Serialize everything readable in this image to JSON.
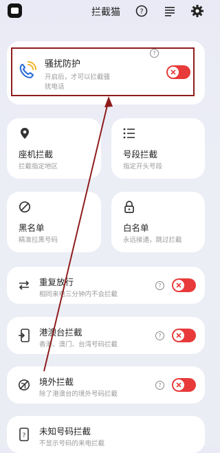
{
  "header": {
    "title": "拦截猫",
    "icons": [
      "app-logo-icon",
      "help-icon",
      "list-icon",
      "gear-icon"
    ]
  },
  "harass": {
    "title": "骚扰防护",
    "desc_line1": "开启后，才可以拦截骚",
    "desc_line2": "扰电话",
    "icon": "phone-ring-icon",
    "toggle_on": true
  },
  "grid": [
    {
      "title": "座机拦截",
      "desc": "拦截指定地区",
      "icon": "location-pin-icon"
    },
    {
      "title": "号段拦截",
      "desc": "指定开头号段",
      "icon": "list-icon"
    },
    {
      "title": "黑名单",
      "desc": "精准拉黑号码",
      "icon": "block-icon"
    },
    {
      "title": "白名单",
      "desc": "永远接通，跳过拦截",
      "icon": "lock-icon"
    }
  ],
  "rows": [
    {
      "title": "重复放行",
      "desc": "相同来电三分钟内不会拦截",
      "icon": "repeat-icon",
      "toggle_on": true
    },
    {
      "title": "港澳台拦截",
      "desc": "香港、澳门、台湾号码拦截",
      "icon": "phone-in-icon",
      "toggle_on": true
    },
    {
      "title": "境外拦截",
      "desc": "除了港澳台的境外号码拦截",
      "icon": "globe-off-icon",
      "toggle_on": true
    },
    {
      "title": "未知号码拦截",
      "desc": "不显示号码的来电拦截",
      "icon": "phone-unknown-icon"
    }
  ],
  "colors": {
    "toggle": "#e83a3a",
    "annotation": "#8e1c1c",
    "accent_phone": "#2f6fd6",
    "accent_wave": "#f2b32a"
  }
}
